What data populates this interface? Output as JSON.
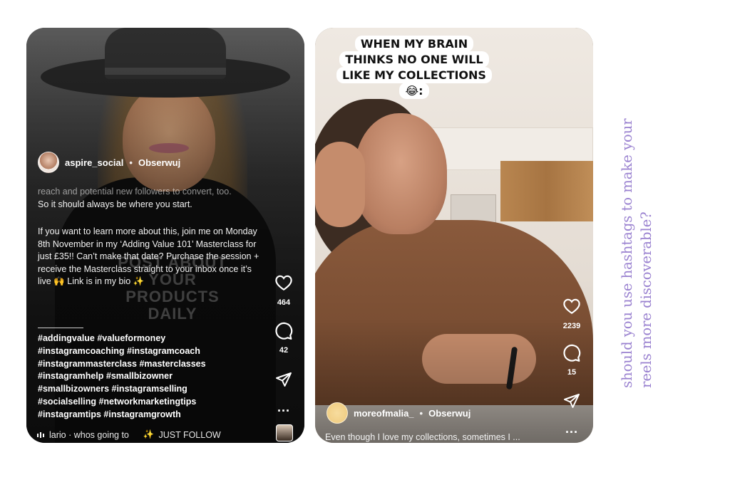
{
  "left_reel": {
    "username": "aspire_social",
    "separator": "•",
    "follow_label": "Obserwuj",
    "caption_faded_lines": [
      "reach and potential new followers to convert, too.",
      "So it should always be where you start."
    ],
    "caption_main": "If you want to learn more about this, join me on Monday 8th November in my ‘Adding Value 101’ Masterclass for just £35!! Can’t make that date? Purchase the session + receive the Masterclass straight to your inbox once it’s live 🙌 Link is in my bio ✨",
    "background_text": "POST ABOUT YOUR PRODUCTS DAILY",
    "hashtags": [
      "#addingvalue #valueformoney",
      "#instagramcoaching #instagramcoach",
      "#instagrammasterclass #masterclasses",
      "#instagramhelp #smallbizowner",
      "#smallbizowners #instagramselling",
      "#socialselling #networkmarketingtips",
      "#instagramtips #instagramgrowth"
    ],
    "likes": "464",
    "comments": "42",
    "more": "...",
    "audio_text": "lario · whos going to",
    "audio_text_2": "JUST FOLLOW",
    "icons": {
      "like": "heart-icon",
      "comment": "comment-icon",
      "share": "send-icon",
      "audio": "audio-wave-icon",
      "sparkle": "sparkle-icon"
    }
  },
  "right_reel": {
    "meme_text": "WHEN MY BRAIN THINKS NO ONE WILL LIKE MY COLLECTIONS 😂:",
    "username": "moreofmalia_",
    "separator": "•",
    "follow_label": "Obserwuj",
    "likes": "2239",
    "comments": "15",
    "more": "...",
    "caption": "Even though I love my collections, sometimes I ...",
    "icons": {
      "like": "heart-icon",
      "comment": "comment-icon",
      "share": "send-icon"
    }
  },
  "side_note": "should you use hashtags to make your reels more discoverable?",
  "colors": {
    "side_note": "#9a82d0",
    "overlay_text": "#ffffff"
  }
}
